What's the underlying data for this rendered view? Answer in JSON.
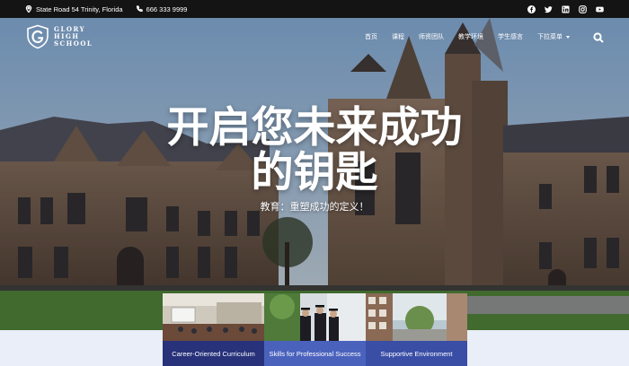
{
  "topbar": {
    "address": "State Road 54 Trinity, Florida",
    "phone": "666 333 9999",
    "socials": [
      "facebook-icon",
      "twitter-icon",
      "linkedin-icon",
      "instagram-icon",
      "youtube-icon"
    ]
  },
  "logo": {
    "line1": "GLORY",
    "line2": "HIGH",
    "line3": "SCHOOL"
  },
  "nav": {
    "items": [
      "首页",
      "课程",
      "师资团队",
      "教学环境",
      "学生感言",
      "下拉菜单"
    ]
  },
  "hero": {
    "headline_line1": "开启您未来成功",
    "headline_line2": "的钥匙",
    "subline": "教育：重塑成功的定义！"
  },
  "cards": [
    {
      "label": "Career-Oriented Curriculum"
    },
    {
      "label": "Skills for Professional Success"
    },
    {
      "label": "Supportive Environment"
    }
  ],
  "colors": {
    "topbar_bg": "#141414",
    "card1": "#27327a",
    "card2": "#4b62bd",
    "card3": "#3a4ea6",
    "band": "#e9eef8"
  }
}
